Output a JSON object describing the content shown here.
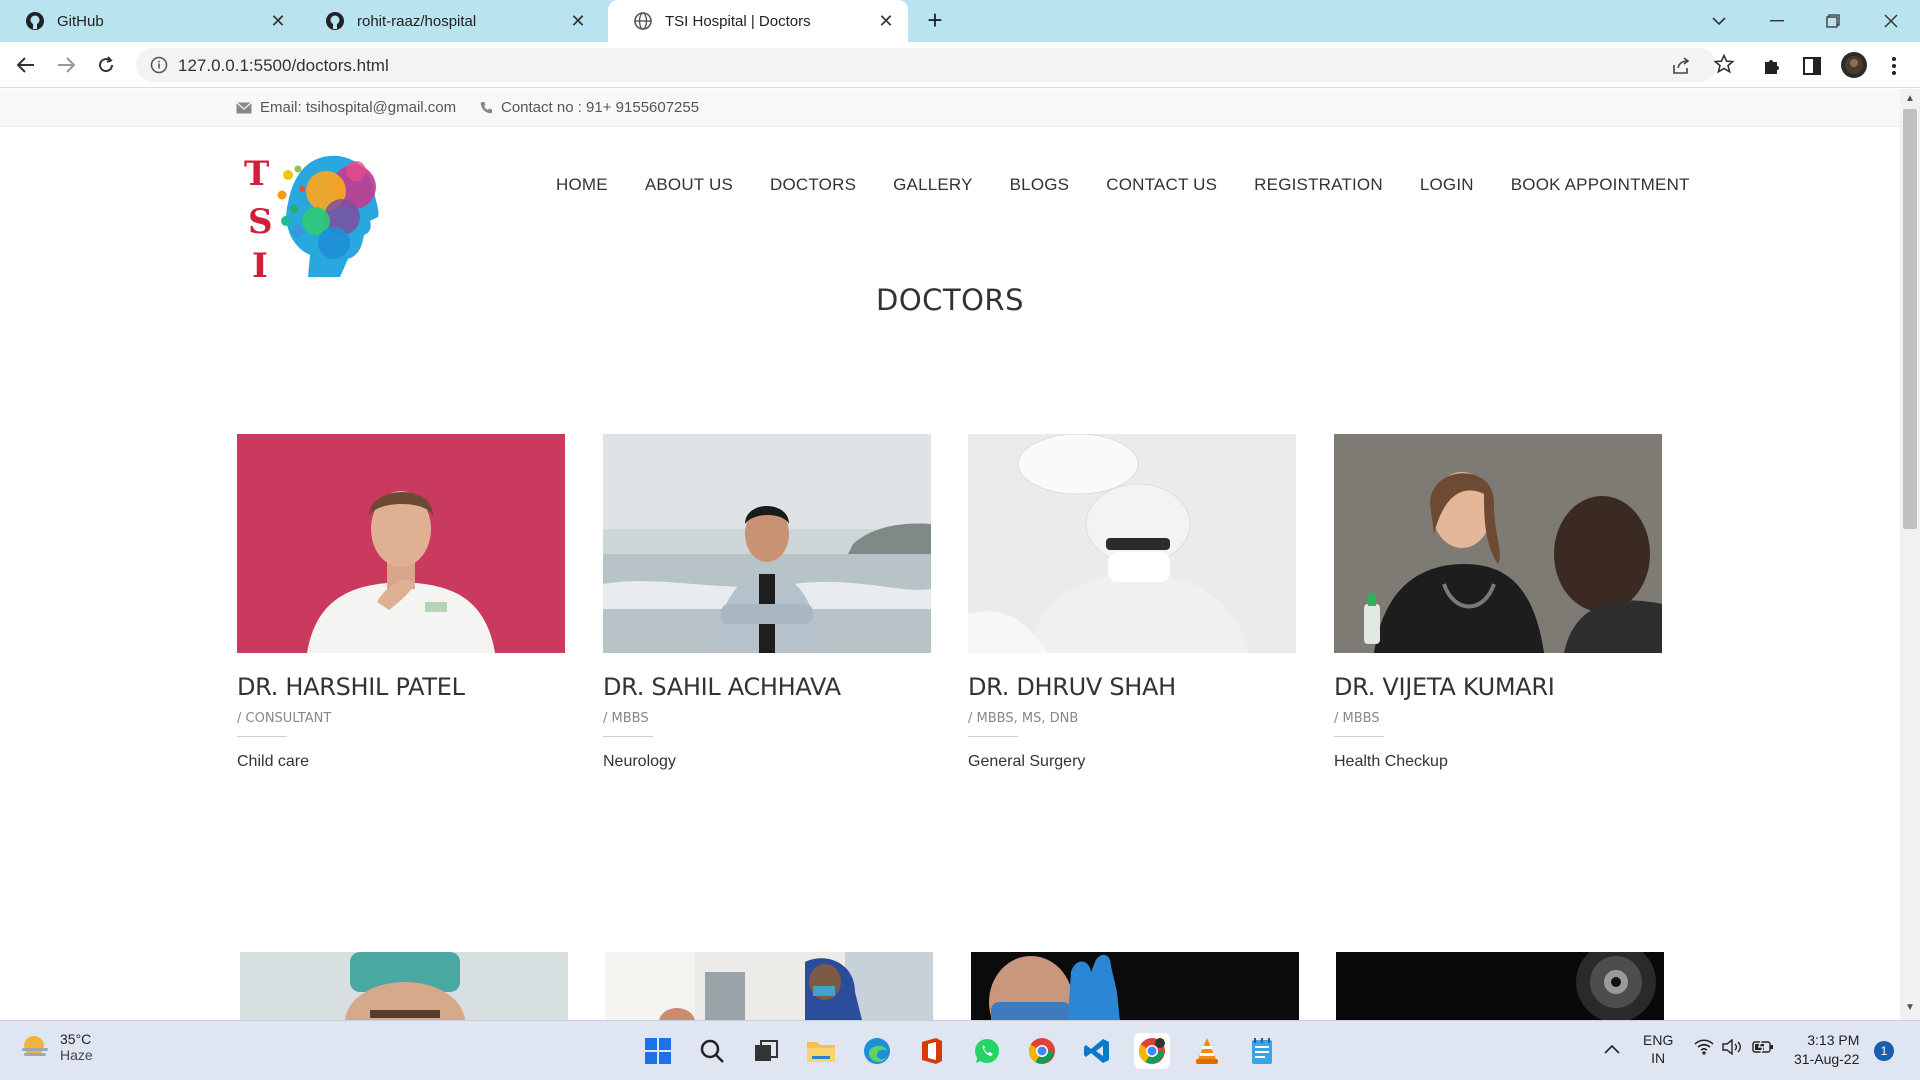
{
  "browser": {
    "tabs": [
      {
        "title": "GitHub",
        "active": false
      },
      {
        "title": "rohit-raaz/hospital",
        "active": false
      },
      {
        "title": "TSI Hospital | Doctors",
        "active": true
      }
    ],
    "url": "127.0.0.1:5500/doctors.html"
  },
  "topbar": {
    "email": "Email: tsihospital@gmail.com",
    "contact": "Contact no : 91+ 9155607255"
  },
  "nav": [
    "HOME",
    "ABOUT US",
    "DOCTORS",
    "GALLERY",
    "BLOGS",
    "CONTACT US",
    "REGISTRATION",
    "LOGIN",
    "BOOK APPOINTMENT"
  ],
  "page_title": "DOCTORS",
  "doctors": [
    {
      "name": "DR. HARSHIL PATEL",
      "qualification": "/ CONSULTANT",
      "specialty": "Child care"
    },
    {
      "name": "DR. SAHIL ACHHAVA",
      "qualification": "/ MBBS",
      "specialty": "Neurology"
    },
    {
      "name": "DR. DHRUV SHAH",
      "qualification": "/ MBBS, MS, DNB",
      "specialty": "General Surgery"
    },
    {
      "name": "DR. VIJETA KUMARI",
      "qualification": "/ MBBS",
      "specialty": "Health Checkup"
    }
  ],
  "taskbar": {
    "temperature": "35°C",
    "weather": "Haze",
    "lang_top": "ENG",
    "lang_bottom": "IN",
    "time": "3:13 PM",
    "date": "31-Aug-22",
    "notifications": "1"
  },
  "colors": {
    "tabbar": "#b9e3ef",
    "taskbar": "#dfe6f2",
    "text": "#333333"
  }
}
